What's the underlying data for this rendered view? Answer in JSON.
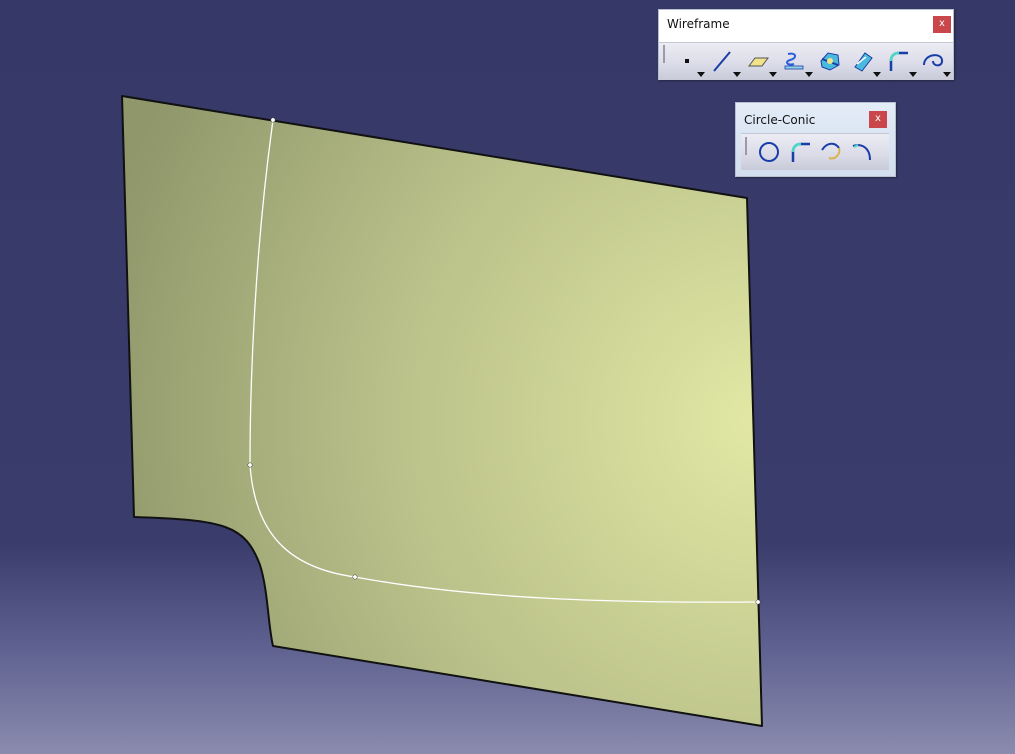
{
  "viewport": {
    "background_top": "#363867",
    "background_bottom": "#8a8bae"
  },
  "surface": {
    "color_dark": "#8f976b",
    "color_light": "#e2e8a4",
    "edge_color": "#111111",
    "curve_color": "#ffffff"
  },
  "toolbars": {
    "wireframe": {
      "title": "Wireframe",
      "close_label": "x",
      "tools": [
        {
          "name": "point-icon",
          "has_dropdown": true
        },
        {
          "name": "line-icon",
          "has_dropdown": true
        },
        {
          "name": "plane-icon",
          "has_dropdown": true
        },
        {
          "name": "projection-icon",
          "has_dropdown": true
        },
        {
          "name": "intersection-icon",
          "has_dropdown": false
        },
        {
          "name": "parallel-curve-icon",
          "has_dropdown": true
        },
        {
          "name": "circle-corner-icon",
          "has_dropdown": true
        },
        {
          "name": "spline-icon",
          "has_dropdown": true
        }
      ]
    },
    "circle_conic": {
      "title": "Circle-Conic",
      "close_label": "x",
      "tools": [
        {
          "name": "circle-icon"
        },
        {
          "name": "corner-icon"
        },
        {
          "name": "connect-curve-icon"
        },
        {
          "name": "conic-icon"
        }
      ]
    }
  }
}
